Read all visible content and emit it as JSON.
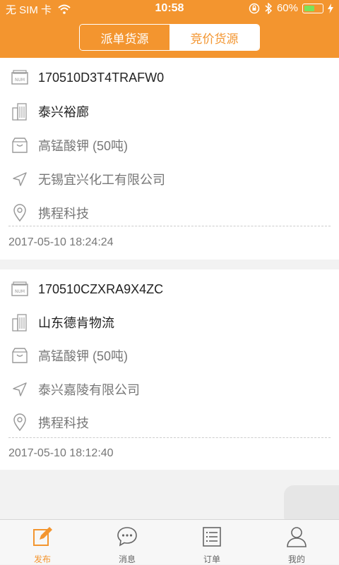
{
  "status_bar": {
    "carrier": "无 SIM 卡",
    "time": "10:58",
    "battery": "60%",
    "battery_level": 0.6
  },
  "segment": {
    "tabs": [
      "派单货源",
      "竞价货源"
    ],
    "selected": 1
  },
  "orders": [
    {
      "code": "170510D3T4TRAFW0",
      "company": "泰兴裕廊",
      "cargo": "高锰酸钾 (50吨)",
      "destination": "无锡宜兴化工有限公司",
      "origin": "携程科技",
      "date": "2017-05-10 18:24:24"
    },
    {
      "code": "170510CZXRA9X4ZC",
      "company": "山东德肯物流",
      "cargo": "高锰酸钾 (50吨)",
      "destination": "泰兴嘉陵有限公司",
      "origin": "携程科技",
      "date": "2017-05-10 18:12:40"
    }
  ],
  "tabbar": {
    "items": [
      "发布",
      "消息",
      "订单",
      "我的"
    ],
    "active": 0
  },
  "colors": {
    "accent": "#f3952f",
    "background": "#f2f2f2"
  }
}
